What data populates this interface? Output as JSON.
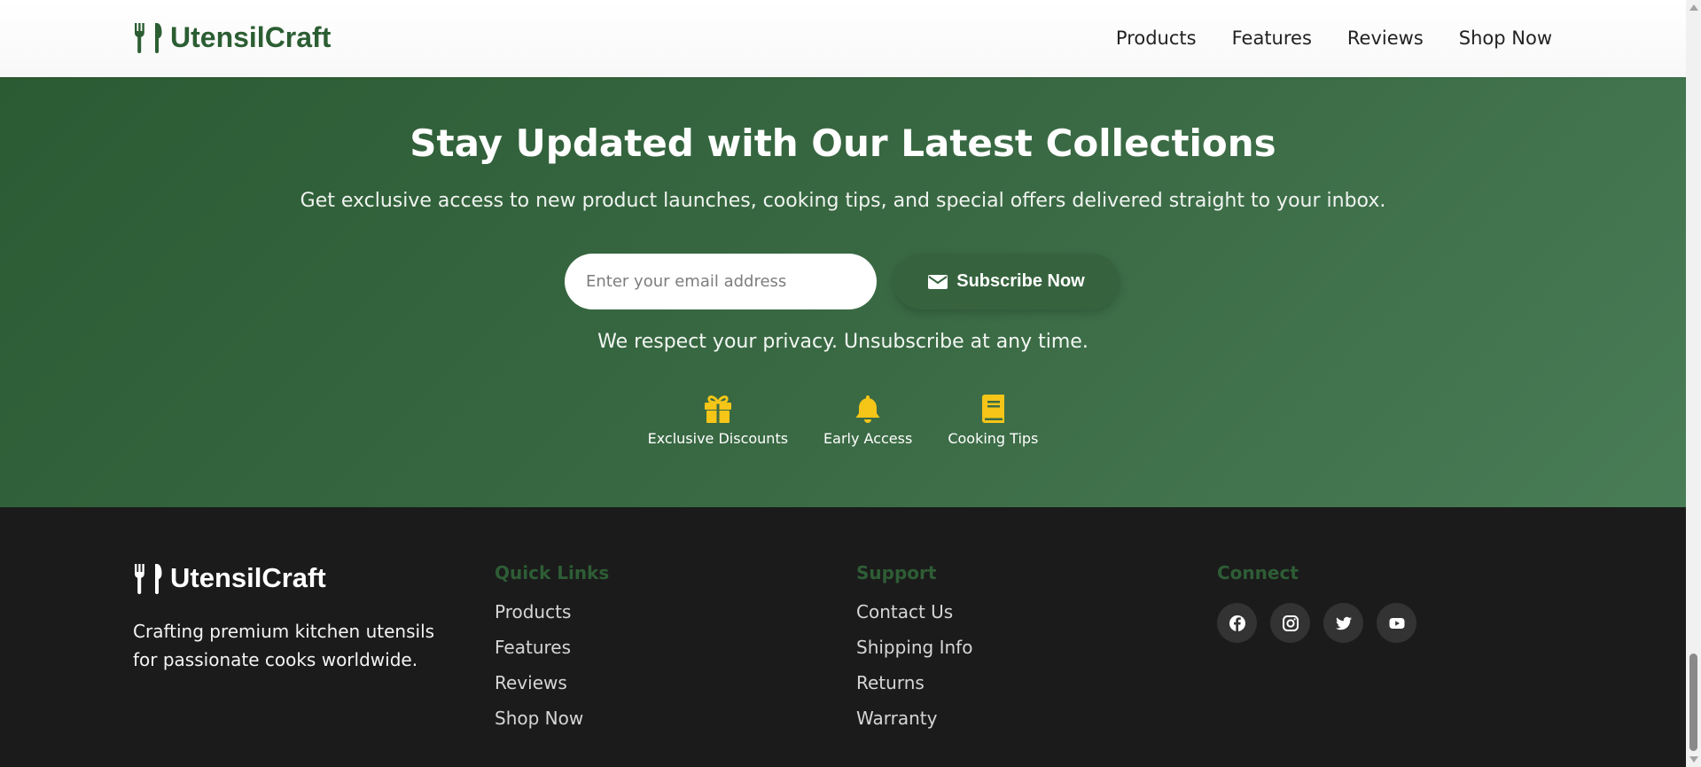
{
  "header": {
    "brand": "UtensilCraft",
    "nav": [
      "Products",
      "Features",
      "Reviews",
      "Shop Now"
    ]
  },
  "newsletter": {
    "title": "Stay Updated with Our Latest Collections",
    "subtitle": "Get exclusive access to new product launches, cooking tips, and special offers delivered straight to your inbox.",
    "email_placeholder": "Enter your email address",
    "email_value": "",
    "subscribe_label": "Subscribe Now",
    "privacy": "We respect your privacy. Unsubscribe at any time.",
    "perks": [
      {
        "label": "Exclusive Discounts",
        "icon": "gift-icon"
      },
      {
        "label": "Early Access",
        "icon": "bell-icon"
      },
      {
        "label": "Cooking Tips",
        "icon": "book-icon"
      }
    ]
  },
  "footer": {
    "brand": "UtensilCraft",
    "tagline": "Crafting premium kitchen utensils for passionate cooks worldwide.",
    "quick_links": {
      "heading": "Quick Links",
      "items": [
        "Products",
        "Features",
        "Reviews",
        "Shop Now"
      ]
    },
    "support": {
      "heading": "Support",
      "items": [
        "Contact Us",
        "Shipping Info",
        "Returns",
        "Warranty"
      ]
    },
    "connect": {
      "heading": "Connect",
      "social": [
        "facebook-icon",
        "instagram-icon",
        "twitter-icon",
        "youtube-icon"
      ]
    }
  },
  "colors": {
    "brand_green": "#2c5e33",
    "section_gradient_start": "#2b5b33",
    "section_gradient_end": "#497d56",
    "accent_yellow": "#f5c518",
    "footer_bg": "#1b1b1b"
  }
}
